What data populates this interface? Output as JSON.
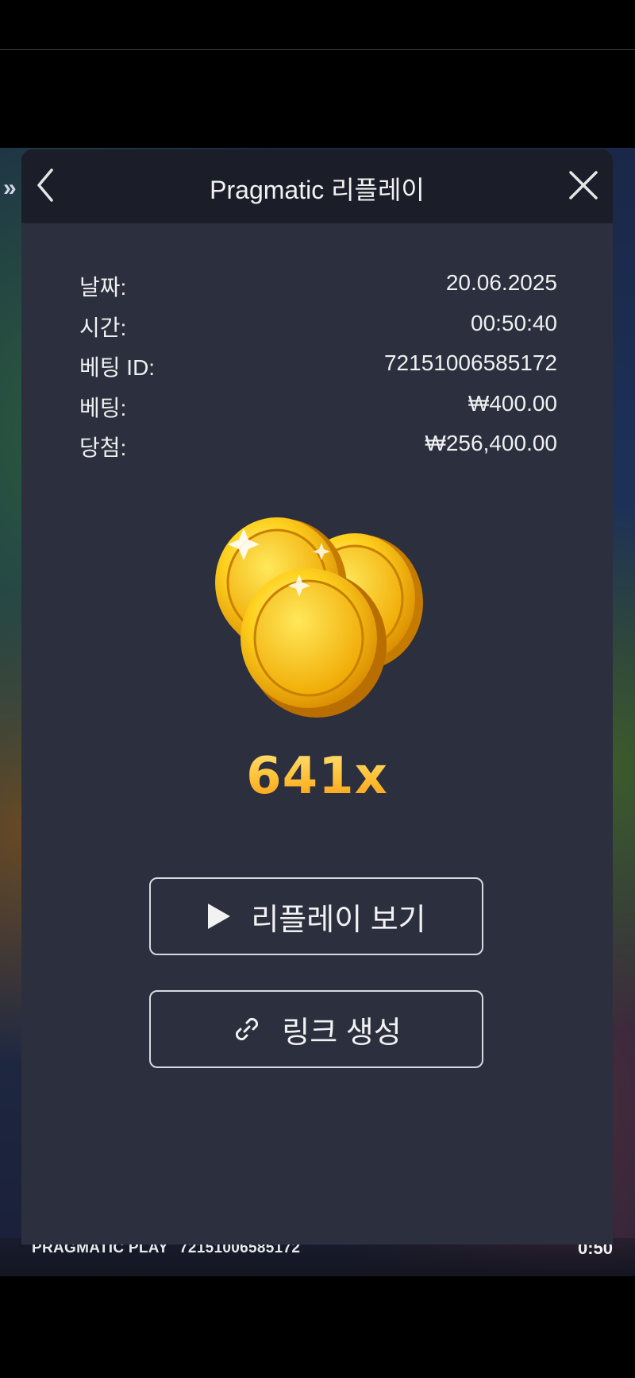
{
  "modal": {
    "title": "Pragmatic 리플레이",
    "back_icon": "chevron-left-icon",
    "close_icon": "close-icon"
  },
  "details": [
    {
      "label": "날짜:",
      "value": "20.06.2025"
    },
    {
      "label": "시간:",
      "value": "00:50:40"
    },
    {
      "label": "베팅 ID:",
      "value": "72151006585172"
    },
    {
      "label": "베팅:",
      "value": "₩400.00"
    },
    {
      "label": "당첨:",
      "value": "₩256,400.00"
    }
  ],
  "win": {
    "multiplier": "641x",
    "graphic": "gold-coins-icon"
  },
  "actions": {
    "replay_label": "리플레이 보기",
    "replay_icon": "play-icon",
    "link_label": "링크 생성",
    "link_icon": "link-icon"
  },
  "game_footer": {
    "brand": "PRAGMATIC PLAY",
    "round_id": "72151006585172",
    "time": "0:50"
  },
  "side_icon": "double-chevron-right-icon",
  "colors": {
    "modal_bg": "#2c2f3e",
    "header_bg": "#1b1d29",
    "multiplier_gold": "#ffc23a"
  }
}
